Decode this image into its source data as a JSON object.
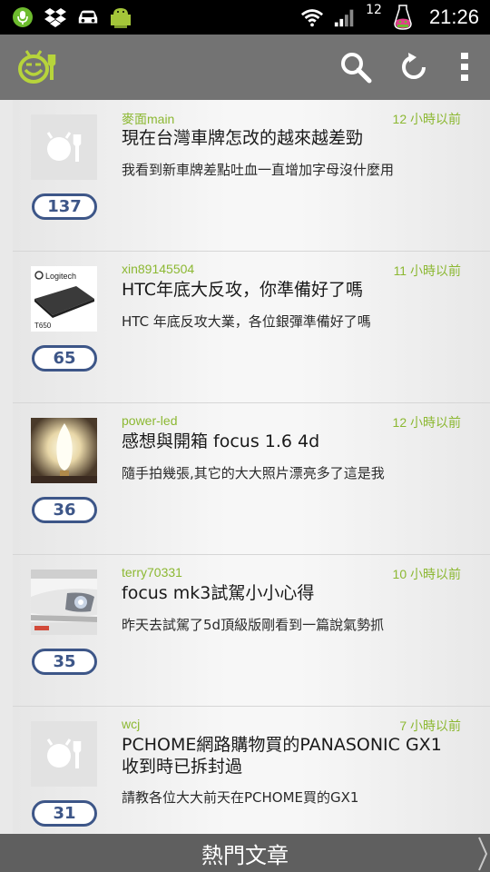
{
  "status_bar": {
    "time": "21:26",
    "notification_count": "12",
    "icons": [
      "microphone-icon",
      "dropbox-icon",
      "car-icon",
      "android-icon",
      "wifi-icon",
      "signal-icon",
      "battery-robot-icon"
    ]
  },
  "action_bar": {
    "logo_icon": "food-face-logo-icon",
    "actions": [
      "search-icon",
      "refresh-icon",
      "overflow-menu-icon"
    ]
  },
  "posts": [
    {
      "author": "麥面main",
      "time": "12 小時以前",
      "title": "現在台灣車牌怎改的越來越差勁",
      "summary": "我看到新車牌差點吐血一直增加字母沒什麼用",
      "count": "137",
      "thumbnail": "placeholder-logo"
    },
    {
      "author": "xin89145504",
      "time": "11 小時以前",
      "title": "HTC年底大反攻，你準備好了嗎",
      "summary": "HTC 年底反攻大業，各位銀彈準備好了嗎",
      "count": "65",
      "thumbnail": "logitech-t650",
      "thumb_brand": "Logitech",
      "thumb_model": "T650"
    },
    {
      "author": "power-led",
      "time": "12 小時以前",
      "title": "感想與開箱 focus 1.6 4d",
      "summary": "隨手拍幾張,其它的大大照片漂亮多了這是我",
      "count": "36",
      "thumbnail": "candle-bulb-photo"
    },
    {
      "author": "terry70331",
      "time": "10 小時以前",
      "title": "focus mk3試駕小小心得",
      "summary": "昨天去試駕了5d頂級版剛看到一篇說氣勢抓",
      "count": "35",
      "thumbnail": "car-headlight-photo"
    },
    {
      "author": "wcj",
      "time": "7 小時以前",
      "title": "PCHOME網路購物買的PANASONIC GX1收到時已拆封過",
      "summary": "請教各位大大前天在PCHOME買的GX1",
      "count": "31",
      "thumbnail": "placeholder-logo"
    }
  ],
  "bottom_bar": {
    "label": "熱門文章"
  },
  "colors": {
    "accent_green": "#8cb832",
    "count_border": "#3d5688",
    "action_bar": "#737373",
    "bottom_bar": "#5f5f5f"
  }
}
